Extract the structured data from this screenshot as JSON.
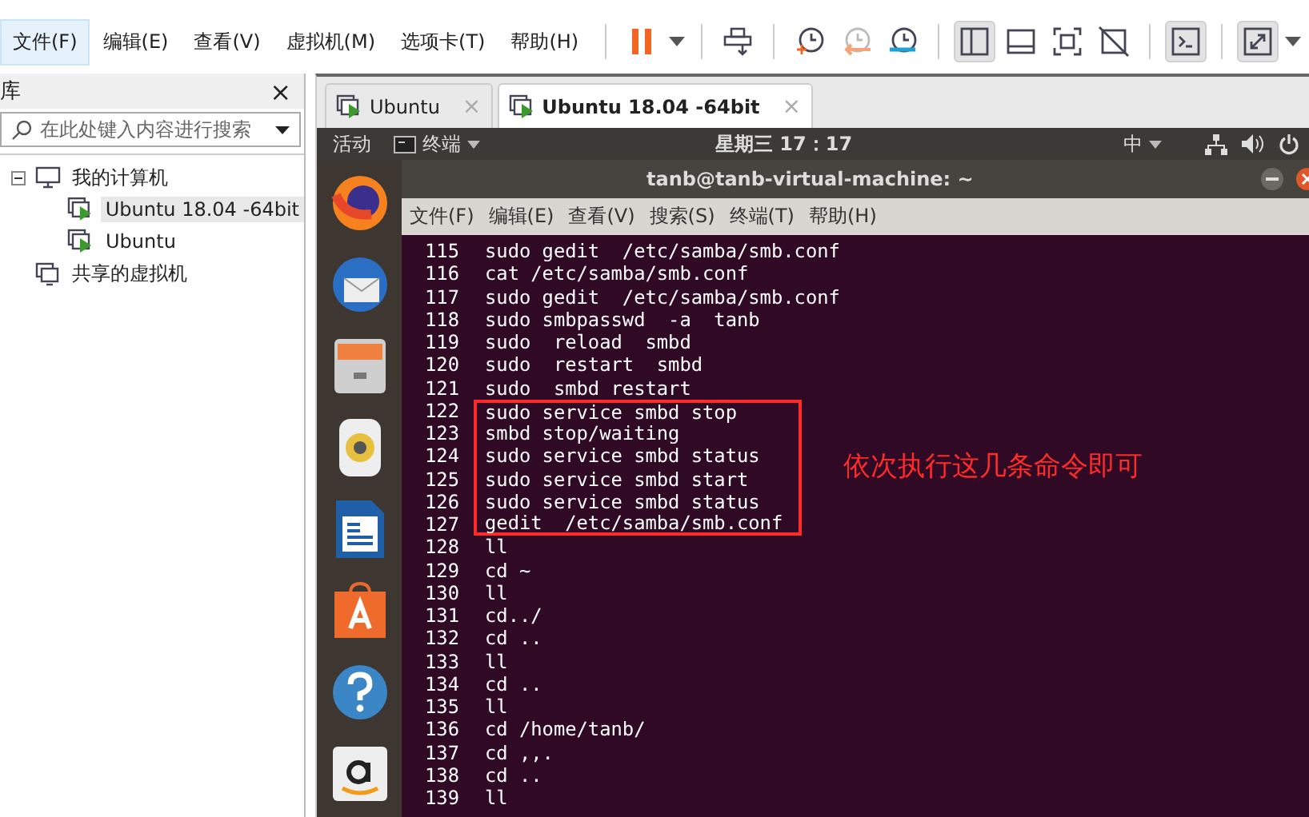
{
  "menu": [
    {
      "label": "文件(F)",
      "selected": true
    },
    {
      "label": "编辑(E)",
      "selected": false
    },
    {
      "label": "查看(V)",
      "selected": false
    },
    {
      "label": "虚拟机(M)",
      "selected": false
    },
    {
      "label": "选项卡(T)",
      "selected": false
    },
    {
      "label": "帮助(H)",
      "selected": false
    }
  ],
  "toolbar": [
    [
      {
        "kind": "pause",
        "pressed": false
      },
      {
        "kind": "caret",
        "pressed": false
      }
    ],
    [
      {
        "kind": "send-keys",
        "pressed": false
      }
    ],
    [
      {
        "kind": "snapshot-take",
        "pressed": false
      },
      {
        "kind": "snapshot-revert",
        "pressed": false
      },
      {
        "kind": "snapshot-manager",
        "pressed": false
      }
    ],
    [
      {
        "kind": "view-library",
        "pressed": true
      },
      {
        "kind": "view-thumbnail",
        "pressed": false
      },
      {
        "kind": "view-fullscreen",
        "pressed": false
      },
      {
        "kind": "view-unity",
        "pressed": false
      }
    ],
    [
      {
        "kind": "console",
        "pressed": true
      }
    ],
    [
      {
        "kind": "stretch",
        "pressed": true
      },
      {
        "kind": "caret",
        "pressed": false
      }
    ]
  ],
  "library": {
    "title": "库",
    "close": "×",
    "search": {
      "placeholder": "在此处键入内容进行搜索"
    },
    "tree": [
      {
        "label": "我的计算机",
        "kind": "computer",
        "expanded": true,
        "selected": false,
        "children": [
          {
            "label": "Ubuntu 18.04 -64bit",
            "selected": true
          },
          {
            "label": "Ubuntu",
            "selected": false
          }
        ]
      },
      {
        "label": "共享的虚拟机",
        "kind": "shared",
        "selected": false
      }
    ]
  },
  "tabs": [
    {
      "label": "Ubuntu",
      "selected": false,
      "close": "×"
    },
    {
      "label": "Ubuntu 18.04 -64bit",
      "selected": true,
      "close": "×"
    }
  ],
  "guest": {
    "activities": "活动",
    "app_menu": "终端",
    "clock": "星期三 17：17",
    "input_method": "中",
    "dock": [
      {
        "kind": "firefox"
      },
      {
        "kind": "mail"
      },
      {
        "kind": "files"
      },
      {
        "kind": "music"
      },
      {
        "kind": "writer"
      },
      {
        "kind": "store"
      },
      {
        "kind": "help"
      },
      {
        "kind": "amazon"
      }
    ],
    "terminal": {
      "title": "tanb@tanb-virtual-machine: ~",
      "menu": [
        "文件(F)",
        "编辑(E)",
        "查看(V)",
        "搜索(S)",
        "终端(T)",
        "帮助(H)"
      ],
      "lines": [
        {
          "n": "115",
          "cmd": "sudo gedit  /etc/samba/smb.conf",
          "boxed": false
        },
        {
          "n": "116",
          "cmd": "cat /etc/samba/smb.conf",
          "boxed": false
        },
        {
          "n": "117",
          "cmd": "sudo gedit  /etc/samba/smb.conf",
          "boxed": false
        },
        {
          "n": "118",
          "cmd": "sudo smbpasswd  -a  tanb",
          "boxed": false
        },
        {
          "n": "119",
          "cmd": "sudo  reload  smbd",
          "boxed": false
        },
        {
          "n": "120",
          "cmd": "sudo  restart  smbd",
          "boxed": false
        },
        {
          "n": "121",
          "cmd": "sudo  smbd restart",
          "boxed": false
        },
        {
          "n": "122",
          "cmd": "sudo service smbd stop",
          "boxed": true
        },
        {
          "n": "123",
          "cmd": "smbd stop/waiting",
          "boxed": true
        },
        {
          "n": "124",
          "cmd": "sudo service smbd status",
          "boxed": true
        },
        {
          "n": "125",
          "cmd": "sudo service smbd start",
          "boxed": true
        },
        {
          "n": "126",
          "cmd": "sudo service smbd status",
          "boxed": true
        },
        {
          "n": "127",
          "cmd": "gedit  /etc/samba/smb.conf",
          "boxed": true
        },
        {
          "n": "128",
          "cmd": "ll",
          "boxed": false
        },
        {
          "n": "129",
          "cmd": "cd ~",
          "boxed": false
        },
        {
          "n": "130",
          "cmd": "ll",
          "boxed": false
        },
        {
          "n": "131",
          "cmd": "cd../",
          "boxed": false
        },
        {
          "n": "132",
          "cmd": "cd ..",
          "boxed": false
        },
        {
          "n": "133",
          "cmd": "ll",
          "boxed": false
        },
        {
          "n": "134",
          "cmd": "cd ..",
          "boxed": false
        },
        {
          "n": "135",
          "cmd": "ll",
          "boxed": false
        },
        {
          "n": "136",
          "cmd": "cd /home/tanb/",
          "boxed": false
        },
        {
          "n": "137",
          "cmd": "cd ,,.",
          "boxed": false
        },
        {
          "n": "138",
          "cmd": "cd ..",
          "boxed": false
        },
        {
          "n": "139",
          "cmd": "ll",
          "boxed": false
        }
      ]
    },
    "annotation": "依次执行这几条命令即可"
  }
}
